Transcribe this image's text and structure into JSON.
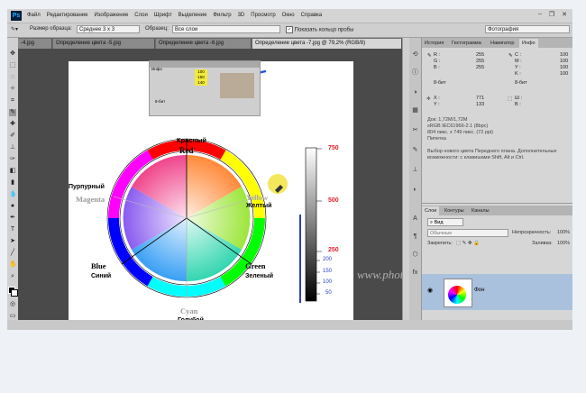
{
  "app": {
    "logo": "Ps"
  },
  "menu": [
    "Файл",
    "Редактирование",
    "Изображение",
    "Слои",
    "Шрифт",
    "Выделение",
    "Фильтр",
    "3D",
    "Просмотр",
    "Окно",
    "Справка"
  ],
  "options": {
    "sample_size_label": "Размер образца:",
    "sample_size_value": "Среднее 3 х 3",
    "sample_label": "Образец:",
    "sample_value": "Все слои",
    "ring_label": "Показать кольцо пробы",
    "workspace": "Фотография"
  },
  "doc_tabs": [
    {
      "label": "-4.jpg",
      "active": false
    },
    {
      "label": "Определение цвета -5.jpg",
      "active": false
    },
    {
      "label": "Определение цвета -6.jpg",
      "active": false
    },
    {
      "label": "Определение цвета -7.jpg @ 79,2% (RGB/8)",
      "active": true
    }
  ],
  "info_shot": {
    "title": "Инфо",
    "values": [
      "100",
      "150",
      "140"
    ],
    "bit": "8-бит"
  },
  "wheel": {
    "labels": {
      "top_en": "Красный",
      "top_en2": "Red",
      "left_ru": "Пурпурный",
      "left_en": "Magenta",
      "right_en": "Yellow",
      "right_ru": "Желтый",
      "bl_en": "Blue",
      "bl_ru": "Синий",
      "br_en": "Green",
      "br_ru": "Зеленый",
      "bottom_en": "Cyan",
      "bottom_ru": "Голубой"
    }
  },
  "scale": {
    "red_ticks": [
      "750",
      "500",
      "250"
    ],
    "blue_ticks": [
      "200",
      "150",
      "100",
      "50"
    ]
  },
  "panel_tabs": [
    "История",
    "Гистограмма",
    "Навигатор",
    "Инфо"
  ],
  "info_panel": {
    "r_label": "R :",
    "r": "255",
    "g_label": "G :",
    "g": "255",
    "b_label": "B :",
    "b": "255",
    "c_label": "C :",
    "c": "100",
    "m_label": "M :",
    "m": "100",
    "y_label": "Y :",
    "y": "100",
    "k_label": "K :",
    "k": "100",
    "bit_left": "8-бит",
    "bit_right": "8-бит",
    "x_label": "X :",
    "x": "771",
    "y2_label": "Y :",
    "y2": "133",
    "w_label": "Ш :",
    "h_label": "В :",
    "doc": "Док: 1,72M/1,72M",
    "profile": "sRGB IEC61966-2.1 (8bpc)",
    "size": "804 пикс. x 749 пикс. (72 ppi)",
    "tool": "Пипетка",
    "hint": "Выбор нового цвета Переднего плана. Дополнительные возможности: с клавишами Shift, Alt и Ctrl."
  },
  "layers_tabs": [
    "Слои",
    "Контуры",
    "Каналы"
  ],
  "layers": {
    "kind": "Вид",
    "blend": "Обычные",
    "opacity_label": "Непрозрачность:",
    "opacity": "100%",
    "lock_label": "Закрепить:",
    "fill_label": "Заливка:",
    "fill": "100%",
    "layer_name": "Фон"
  },
  "watermark": "www.photoshopsunduchok.ru",
  "colors": {
    "accent_blue": "#1f4fd6",
    "scale_red": "#e8202a",
    "scale_blue": "#2a3fc8"
  }
}
